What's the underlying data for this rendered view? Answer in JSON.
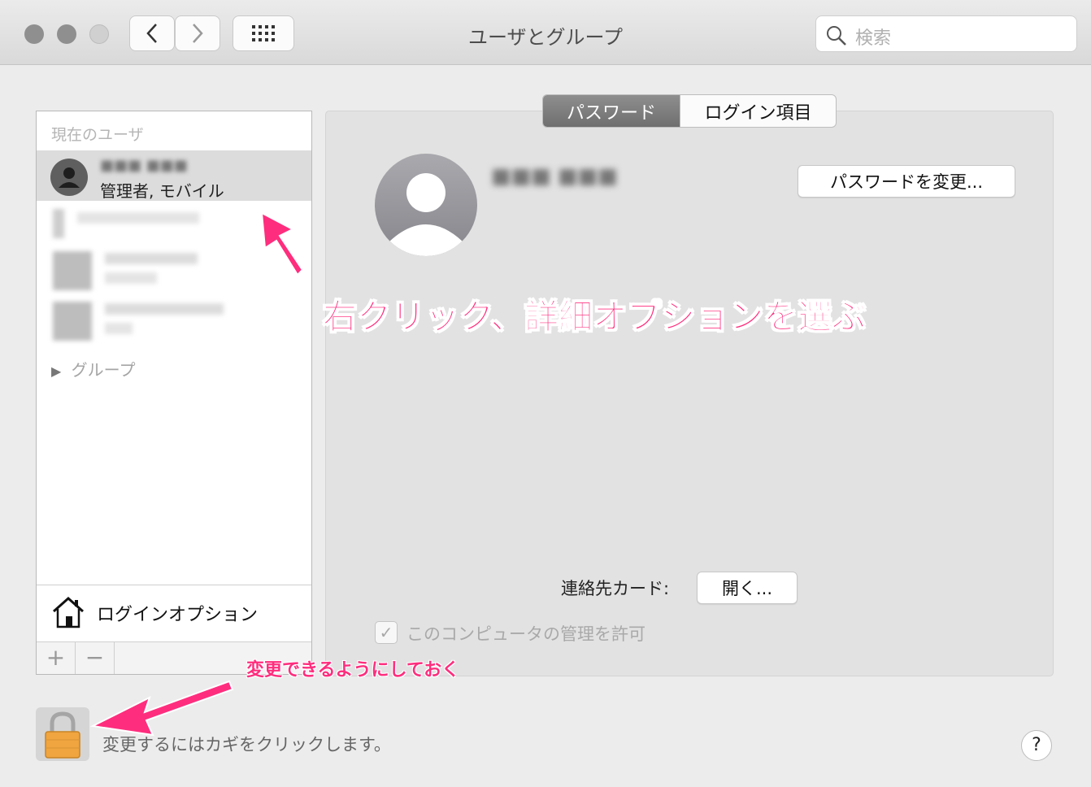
{
  "window": {
    "title": "ユーザとグループ",
    "search_placeholder": "検索"
  },
  "sidebar": {
    "section_current": "現在のユーザ",
    "current_user": {
      "name": "■■■ ■■■",
      "role": "管理者, モバイル"
    },
    "groups_label": "グループ",
    "login_options": "ログインオプション",
    "add_symbol": "+",
    "remove_symbol": "−"
  },
  "tabs": {
    "password": "パスワード",
    "login_items": "ログイン項目",
    "active": "password"
  },
  "detail": {
    "user_name": "■■■ ■■■",
    "change_password_button": "パスワードを変更...",
    "contact_card_label": "連絡先カード:",
    "open_button": "開く...",
    "allow_admin_label": "このコンピュータの管理を許可",
    "allow_admin_checked": true
  },
  "footer": {
    "lock_message": "変更するにはカギをクリックします。",
    "help_symbol": "?"
  },
  "annotations": {
    "main": "右クリック、詳細オプションを選ぶ",
    "lock_note": "変更できるようにしておく",
    "color": "#ff2d7d"
  },
  "icons": [
    "chevron-left-icon",
    "chevron-right-icon",
    "grid-icon",
    "search-icon",
    "user-silhouette-icon",
    "house-icon",
    "disclosure-triangle-icon",
    "lock-icon",
    "checkmark-icon",
    "question-icon"
  ]
}
